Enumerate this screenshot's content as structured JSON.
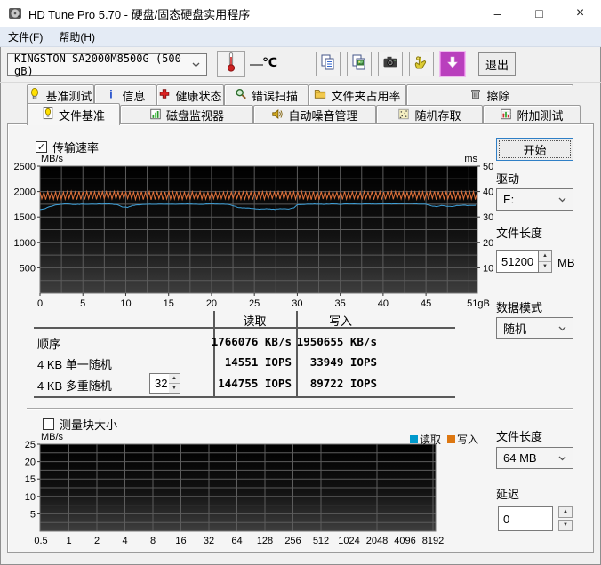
{
  "window": {
    "title": "HD Tune Pro 5.70 - 硬盘/固态硬盘实用程序",
    "minimize": "–",
    "maximize": "□",
    "close": "×"
  },
  "menu": {
    "file": "文件(F)",
    "help": "帮助(H)"
  },
  "toolbar": {
    "device": "KINGSTON SA2000M8500G (500 gB)",
    "temp_value": "—",
    "temp_unit": "℃",
    "exit": "退出"
  },
  "tabs": {
    "row1": [
      {
        "label": "基准测试"
      },
      {
        "label": "信息"
      },
      {
        "label": "健康状态"
      },
      {
        "label": "错误扫描"
      },
      {
        "label": "文件夹占用率"
      },
      {
        "label": "擦除"
      }
    ],
    "row2": [
      {
        "label": "文件基准",
        "active": true
      },
      {
        "label": "磁盘监视器"
      },
      {
        "label": "自动噪音管理"
      },
      {
        "label": "随机存取"
      },
      {
        "label": "附加测试"
      }
    ]
  },
  "transfer": {
    "checkbox_label": "传输速率",
    "checked": true
  },
  "blocksize": {
    "checkbox_label": "测量块大小",
    "checked": false,
    "legend": [
      {
        "label": "读取",
        "color": "#0099CC"
      },
      {
        "label": "写入",
        "color": "#DD7711"
      }
    ]
  },
  "controls": {
    "start": "开始",
    "drive_label": "驱动",
    "drive": "E:",
    "file_length_label": "文件长度",
    "file_length": "51200",
    "file_length_unit": "MB",
    "data_mode_label": "数据模式",
    "data_mode": "随机",
    "file_length2_label": "文件长度",
    "file_length2": "64 MB",
    "delay_label": "延迟",
    "delay": "0"
  },
  "results": {
    "read_header": "读取",
    "write_header": "写入",
    "rows": [
      {
        "label": "顺序",
        "read": "1766076 KB/s",
        "write": "1950655 KB/s"
      },
      {
        "label": "4 KB 单一随机",
        "read": "14551 IOPS",
        "write": "33949 IOPS"
      },
      {
        "label": "4 KB 多重随机",
        "queue": "32",
        "read": "144755 IOPS",
        "write": "89722 IOPS"
      }
    ]
  },
  "chart_data": [
    {
      "type": "line",
      "title": "传输速率",
      "ylabel_left": "MB/s",
      "ylabel_right": "ms",
      "ylim_left": [
        0,
        2500
      ],
      "y_ticks_left": [
        500,
        1000,
        1500,
        2000,
        2500
      ],
      "ylim_right": [
        0,
        50
      ],
      "y_ticks_right": [
        10,
        20,
        30,
        40,
        50
      ],
      "x_max": 51,
      "x_ticks": [
        0,
        5,
        10,
        15,
        20,
        25,
        30,
        35,
        40,
        45
      ],
      "x_end_label": "51gB",
      "grid": true,
      "grid_step_x": 2.5,
      "grid_step_y": 250,
      "series": [
        {
          "name": "读取",
          "color": "#3FA0D8",
          "pattern": "smooth",
          "unit": "MB/s",
          "points": [
            [
              0,
              1645
            ],
            [
              0.6,
              1665
            ],
            [
              1.2,
              1705
            ],
            [
              2,
              1742
            ],
            [
              3,
              1758
            ],
            [
              4,
              1742
            ],
            [
              5,
              1752
            ],
            [
              6,
              1748
            ],
            [
              7,
              1756
            ],
            [
              8,
              1760
            ],
            [
              9,
              1740
            ],
            [
              9.6,
              1698
            ],
            [
              10.2,
              1688
            ],
            [
              10.8,
              1725
            ],
            [
              12,
              1748
            ],
            [
              13,
              1752
            ],
            [
              14,
              1748
            ],
            [
              15,
              1754
            ],
            [
              16,
              1748
            ],
            [
              17,
              1756
            ],
            [
              18,
              1752
            ],
            [
              19,
              1748
            ],
            [
              20,
              1762
            ],
            [
              21,
              1752
            ],
            [
              22,
              1748
            ],
            [
              22.7,
              1712
            ],
            [
              23.2,
              1682
            ],
            [
              24,
              1676
            ],
            [
              25,
              1664
            ],
            [
              25.6,
              1652
            ],
            [
              26.5,
              1660
            ],
            [
              27.4,
              1650
            ],
            [
              28.2,
              1662
            ],
            [
              29,
              1656
            ],
            [
              29.6,
              1676
            ],
            [
              30,
              1740
            ],
            [
              31,
              1748
            ],
            [
              32,
              1754
            ],
            [
              33,
              1748
            ],
            [
              34,
              1756
            ],
            [
              35,
              1750
            ],
            [
              36,
              1756
            ],
            [
              37,
              1750
            ],
            [
              38,
              1756
            ],
            [
              39,
              1752
            ],
            [
              40,
              1762
            ],
            [
              41,
              1756
            ],
            [
              42,
              1760
            ],
            [
              43,
              1766
            ],
            [
              44,
              1756
            ],
            [
              45,
              1748
            ],
            [
              45.6,
              1718
            ],
            [
              46.2,
              1704
            ],
            [
              46.8,
              1726
            ],
            [
              47.4,
              1712
            ],
            [
              48,
              1704
            ],
            [
              48.6,
              1722
            ],
            [
              49.2,
              1732
            ],
            [
              50,
              1724
            ],
            [
              51,
              1730
            ]
          ]
        },
        {
          "name": "写入",
          "color": "#E0713A",
          "pattern": "oscillation",
          "unit": "MB/s",
          "y_top": 2005,
          "y_bottom": 1838,
          "cycles": 112
        }
      ]
    },
    {
      "type": "line",
      "title": "测量块大小",
      "ylabel": "MB/s",
      "ylim": [
        0,
        25
      ],
      "y_ticks": [
        5,
        10,
        15,
        20,
        25
      ],
      "categories": [
        "0.5",
        "1",
        "2",
        "4",
        "8",
        "16",
        "32",
        "64",
        "128",
        "256",
        "512",
        "1024",
        "2048",
        "4096",
        "8192"
      ],
      "grid": true,
      "series": [
        {
          "name": "读取",
          "color": "#0099CC",
          "values": []
        },
        {
          "name": "写入",
          "color": "#DD7711",
          "values": []
        }
      ]
    }
  ]
}
